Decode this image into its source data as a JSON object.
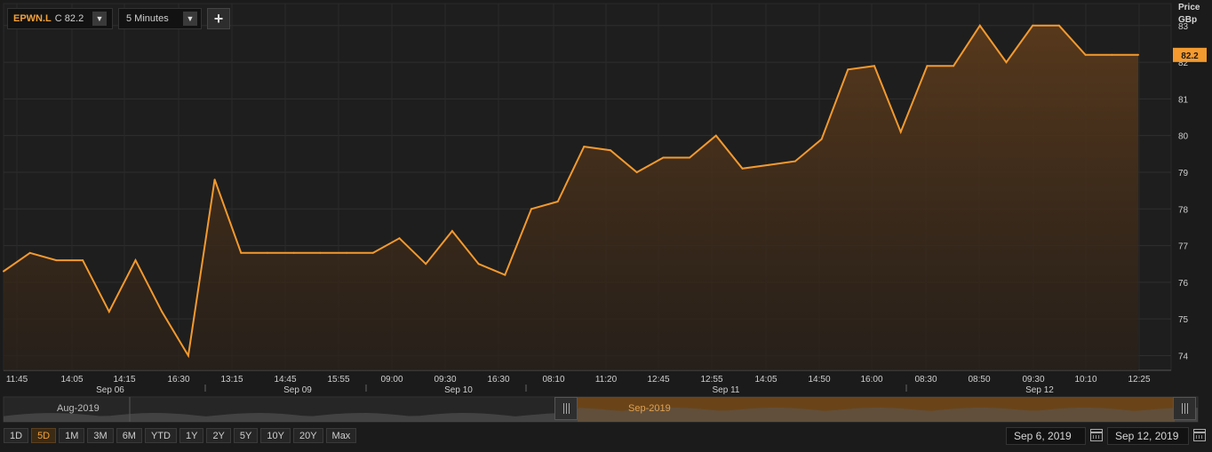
{
  "toolbar": {
    "symbol": "EPWN.L",
    "close_label": "C 82.2",
    "interval": "5 Minutes",
    "add_label": "+"
  },
  "axis": {
    "title_line1": "Price",
    "title_line2": "GBp",
    "last_price_badge": "82.2"
  },
  "chart_data": {
    "type": "area",
    "series": [
      {
        "values": [
          76.3,
          76.8,
          76.6,
          76.6,
          75.2,
          76.6,
          75.2,
          74.0,
          78.8,
          76.8,
          76.8,
          76.8,
          76.8,
          76.8,
          76.8,
          77.2,
          76.5,
          77.4,
          76.5,
          76.2,
          78.0,
          78.2,
          79.7,
          79.6,
          79.0,
          79.4,
          79.4,
          80.0,
          79.1,
          79.2,
          79.3,
          79.9,
          81.8,
          81.9,
          80.1,
          81.9,
          81.9,
          83.0,
          82.0,
          83.0,
          83.0,
          82.2,
          82.2,
          82.2
        ]
      }
    ],
    "ylim": [
      73.6,
      83.6
    ],
    "y_ticks": [
      74,
      75,
      76,
      77,
      78,
      79,
      80,
      81,
      82,
      83
    ],
    "x_time_labels": [
      "11:45",
      "14:05",
      "14:15",
      "16:30",
      "13:15",
      "14:45",
      "15:55",
      "09:00",
      "09:30",
      "16:30",
      "08:10",
      "11:20",
      "12:45",
      "12:55",
      "14:05",
      "14:50",
      "16:00",
      "08:30",
      "08:50",
      "09:30",
      "10:10",
      "12:25"
    ],
    "x_day_labels": [
      "Sep 06",
      "Sep 09",
      "Sep 10",
      "Sep 11",
      "Sep 12"
    ],
    "grid": true,
    "line_color": "#f49a2e",
    "fill_color": "#4a3320"
  },
  "navigator": {
    "left_label": "Aug-2019",
    "right_label": "Sep-2019"
  },
  "range_buttons": [
    "1D",
    "5D",
    "1M",
    "3M",
    "6M",
    "YTD",
    "1Y",
    "2Y",
    "5Y",
    "10Y",
    "20Y",
    "Max"
  ],
  "active_range": "5D",
  "dates": {
    "from": "Sep 6, 2019",
    "to": "Sep 12, 2019"
  }
}
